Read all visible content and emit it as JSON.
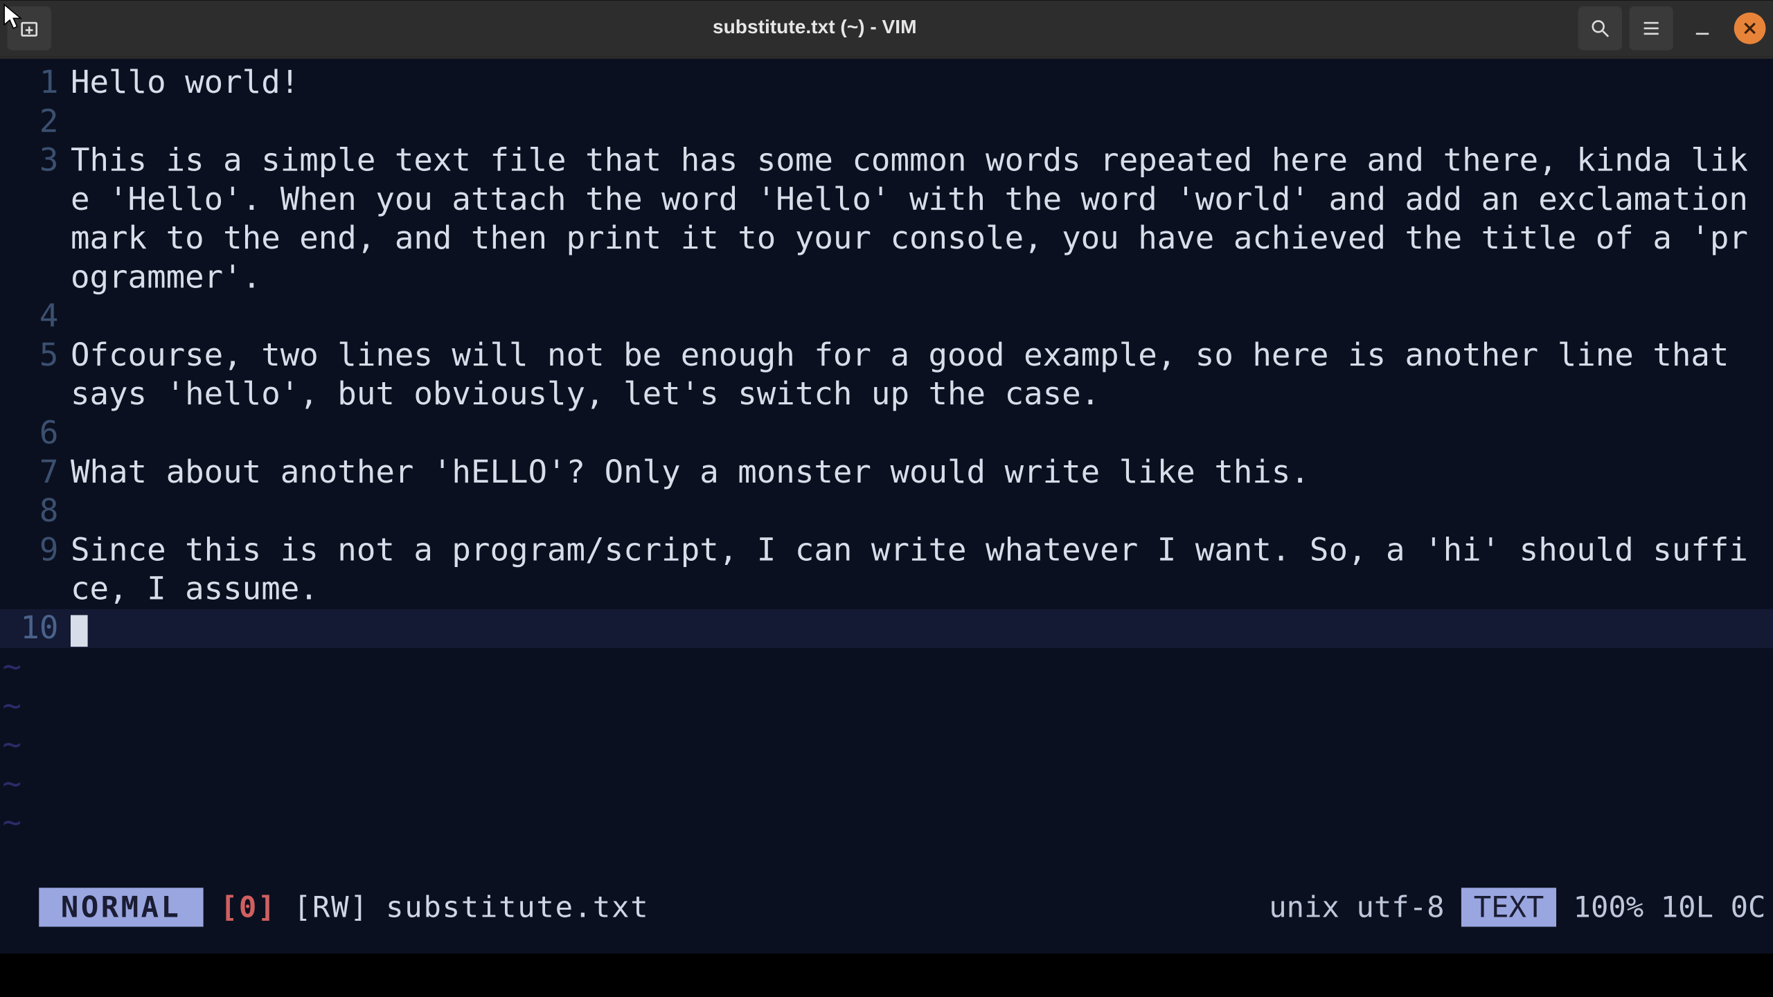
{
  "window": {
    "title": "substitute.txt (~) - VIM"
  },
  "editor": {
    "lines": [
      {
        "num": "1",
        "text": "Hello world!",
        "current": false
      },
      {
        "num": "2",
        "text": "",
        "current": false
      },
      {
        "num": "3",
        "text": "This is a simple text file that has some common words repeated here and there, kinda like 'Hello'. When you attach the word 'Hello' with the word 'world' and add an exclamation mark to the end, and then print it to your console, you have achieved the title of a 'programmer'.",
        "current": false
      },
      {
        "num": "4",
        "text": "",
        "current": false
      },
      {
        "num": "5",
        "text": "Ofcourse, two lines will not be enough for a good example, so here is another line that says 'hello', but obviously, let's switch up the case.",
        "current": false
      },
      {
        "num": "6",
        "text": "",
        "current": false
      },
      {
        "num": "7",
        "text": "What about another 'hELLO'? Only a monster would write like this.",
        "current": false
      },
      {
        "num": "8",
        "text": "",
        "current": false
      },
      {
        "num": "9",
        "text": "Since this is not a program/script, I can write whatever I want. So, a 'hi' should suffice, I assume.",
        "current": false
      },
      {
        "num": "10",
        "text": "",
        "current": true
      }
    ],
    "tilde_count": 5
  },
  "status": {
    "mode": "NORMAL",
    "register": "[0]",
    "rw": "[RW]",
    "filename": "substitute.txt",
    "fileformat": "unix",
    "encoding": "utf-8",
    "filetype": "TEXT",
    "percent": "100%",
    "lines": "10L",
    "column": "0C"
  }
}
